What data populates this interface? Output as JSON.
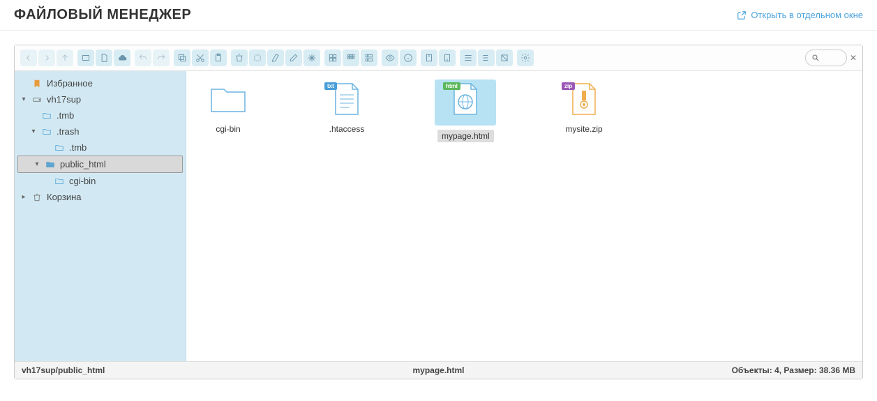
{
  "header": {
    "title": "ФАЙЛОВЫЙ МЕНЕДЖЕР",
    "open_link": "Открыть в отдельном окне"
  },
  "toolbar": {
    "groups": [
      [
        "back",
        "forward",
        "up"
      ],
      [
        "new-folder",
        "new-file",
        "upload"
      ],
      [
        "undo",
        "redo"
      ],
      [
        "copy",
        "cut",
        "paste"
      ],
      [
        "delete",
        "empty",
        "duplicate",
        "rename",
        "edit"
      ],
      [
        "view-icons",
        "view-list",
        "view-columns"
      ],
      [
        "preview",
        "info"
      ],
      [
        "extract",
        "archive"
      ],
      [
        "select-all",
        "select-none",
        "invert"
      ],
      [
        "settings"
      ]
    ]
  },
  "tree": {
    "favorites": "Избранное",
    "root": "vh17sup",
    "tmb": ".tmb",
    "trash": ".trash",
    "tmb2": ".tmb",
    "public_html": "public_html",
    "cgibin": "cgi-bin",
    "recycle": "Корзина"
  },
  "files": [
    {
      "name": "cgi-bin",
      "type": "folder"
    },
    {
      "name": ".htaccess",
      "type": "txt"
    },
    {
      "name": "mypage.html",
      "type": "html",
      "selected": true
    },
    {
      "name": "mysite.zip",
      "type": "zip"
    }
  ],
  "status": {
    "path": "vh17sup/public_html",
    "selected": "mypage.html",
    "summary_label": "Объекты: ",
    "count": "4",
    "size_label": ", Размер: ",
    "size": "38.36 MB"
  }
}
